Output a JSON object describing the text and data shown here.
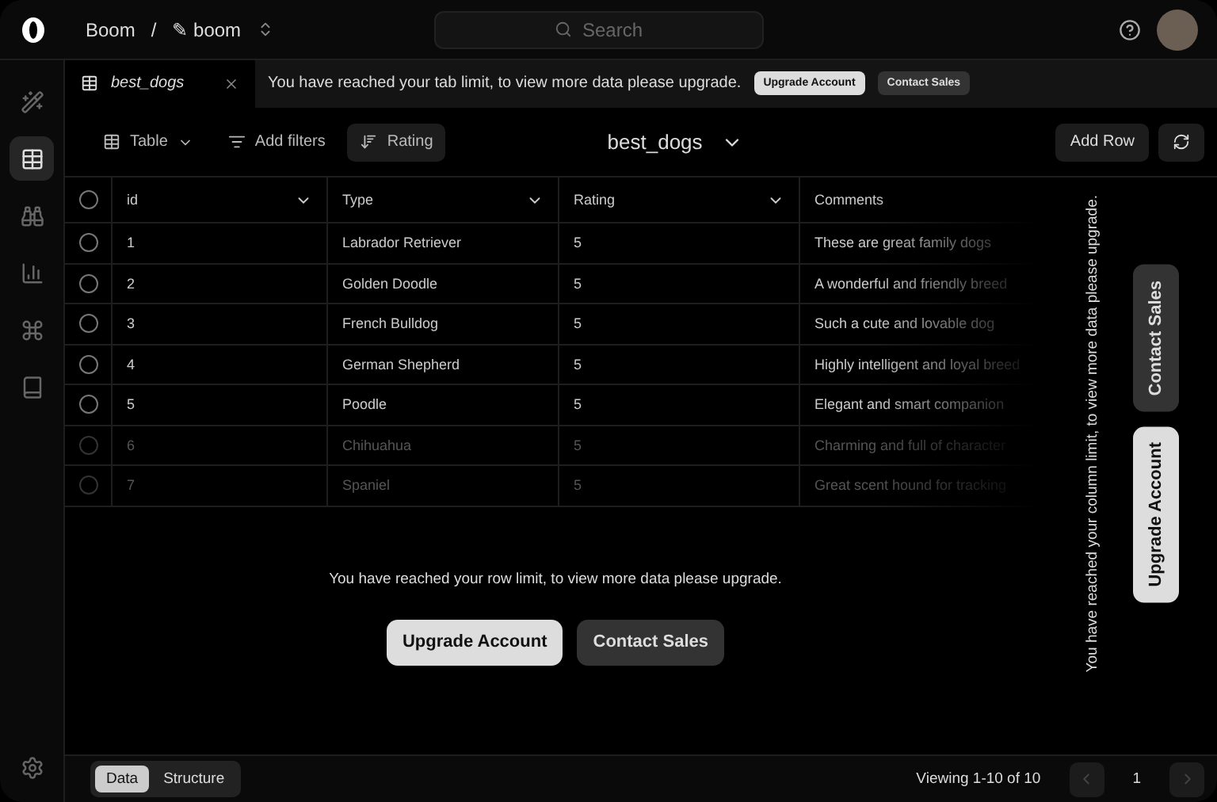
{
  "topbar": {
    "workspace": "Boom",
    "separator": "/",
    "project": "✎ boom",
    "search": {
      "placeholder": "Search"
    }
  },
  "sidebar": {
    "items": [
      {
        "selected": false
      },
      {
        "selected": true
      },
      {
        "selected": false
      },
      {
        "selected": false
      },
      {
        "selected": false
      },
      {
        "selected": false
      }
    ]
  },
  "tabs": [
    {
      "label": "best_dogs",
      "selected": true
    }
  ],
  "tab_limit": {
    "message": "You have reached your tab limit, to view more data please upgrade.",
    "buttons": [
      {
        "label": "Upgrade Account",
        "kind": "primary"
      },
      {
        "label": "Contact Sales",
        "kind": "secondary"
      }
    ]
  },
  "toolbar": {
    "view": "Table",
    "filters": "Add filters",
    "sort": {
      "label": "Rating",
      "active": true
    },
    "title": "best_dogs",
    "add_row": "Add Row"
  },
  "table": {
    "all_checked": false,
    "columns": [
      {
        "label": "id",
        "menu": true
      },
      {
        "label": "Type",
        "menu": true
      },
      {
        "label": "Rating",
        "menu": true
      },
      {
        "label": "Comments",
        "menu": false
      }
    ],
    "rows": [
      {
        "checked": false,
        "faded": false,
        "cells": [
          "1",
          "Labrador Retriever",
          "5",
          "These are great family dogs"
        ]
      },
      {
        "checked": false,
        "faded": false,
        "cells": [
          "2",
          "Golden Doodle",
          "5",
          "A wonderful and friendly breed"
        ]
      },
      {
        "checked": false,
        "faded": false,
        "cells": [
          "3",
          "French Bulldog",
          "5",
          "Such a cute and lovable dog"
        ]
      },
      {
        "checked": false,
        "faded": false,
        "cells": [
          "4",
          "German Shepherd",
          "5",
          "Highly intelligent and loyal breed"
        ]
      },
      {
        "checked": false,
        "faded": false,
        "cells": [
          "5",
          "Poodle",
          "5",
          "Elegant and smart companion"
        ]
      },
      {
        "checked": false,
        "faded": true,
        "cells": [
          "6",
          "Chihuahua",
          "5",
          "Charming and full of character"
        ]
      },
      {
        "checked": false,
        "faded": true,
        "cells": [
          "7",
          "Spaniel",
          "5",
          "Great scent hound for tracking"
        ]
      }
    ]
  },
  "row_limit": {
    "message": "You have reached your row limit, to view more data please upgrade.",
    "buttons": [
      {
        "label": "Upgrade Account",
        "kind": "primary"
      },
      {
        "label": "Contact Sales",
        "kind": "secondary"
      }
    ]
  },
  "column_limit": {
    "message": "You have reached your column limit, to view more data please upgrade.",
    "buttons": [
      {
        "label": "Contact Sales",
        "kind": "secondary"
      },
      {
        "label": "Upgrade Account",
        "kind": "primary"
      }
    ]
  },
  "footer": {
    "views": [
      {
        "label": "Data",
        "selected": true
      },
      {
        "label": "Structure",
        "selected": false
      }
    ],
    "viewing": "Viewing 1-10 of 10",
    "page": "1"
  }
}
